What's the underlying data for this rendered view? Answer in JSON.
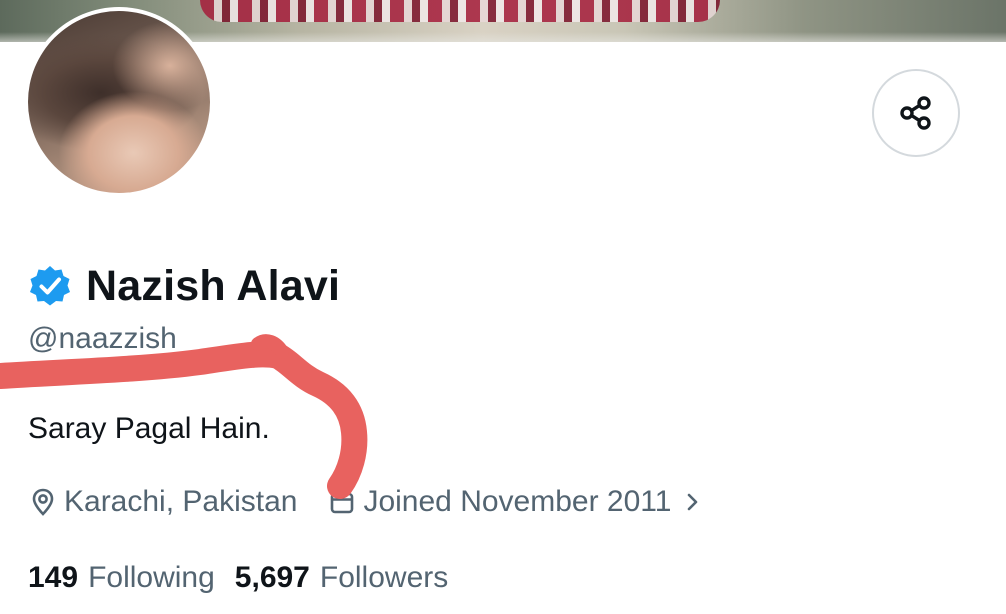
{
  "profile": {
    "display_name": "Nazish Alavi",
    "handle": "@naazzish",
    "bio": "Saray Pagal Hain.",
    "location": "Karachi, Pakistan",
    "joined": "Joined November 2011",
    "verified": true
  },
  "stats": {
    "following_count": "149",
    "following_label": "Following",
    "followers_count": "5,697",
    "followers_label": "Followers"
  },
  "icons": {
    "share": "share-icon",
    "verified": "verified-badge-icon",
    "location": "location-pin-icon",
    "calendar": "calendar-icon",
    "chevron": "chevron-right-icon"
  },
  "colors": {
    "verified_blue": "#1d9bf0",
    "secondary_text": "#536471",
    "primary_text": "#0f1419",
    "redaction_mark": "#e8625f"
  }
}
